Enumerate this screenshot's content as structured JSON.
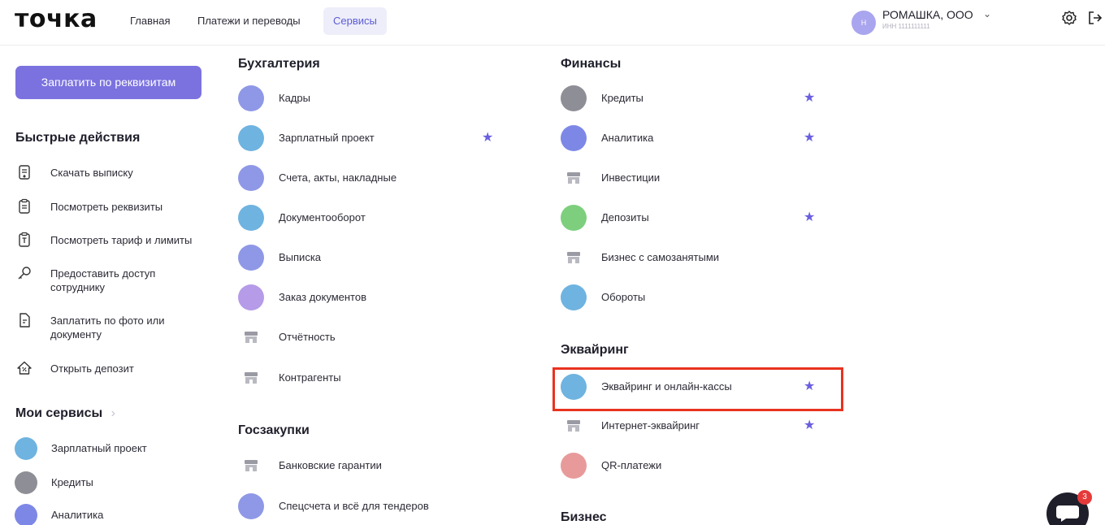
{
  "header": {
    "logo": "точка",
    "nav": [
      {
        "label": "Главная"
      },
      {
        "label": "Платежи и переводы"
      },
      {
        "label": "Сервисы"
      }
    ],
    "account": {
      "avatar": "Н",
      "name": "РОМАШКА, ООО",
      "inn": "ИНН 1111111111"
    },
    "icons": [
      "settings-icon",
      "logout-icon"
    ]
  },
  "left": {
    "pay_button": "Заплатить по реквизитам",
    "quick_actions_title": "Быстрые действия",
    "quick_actions": [
      {
        "label": "Скачать выписку",
        "icon": "statement-icon"
      },
      {
        "label": "Посмотреть реквизиты",
        "icon": "clipboard-icon"
      },
      {
        "label": "Посмотреть тариф и лимиты",
        "icon": "tariff-icon"
      },
      {
        "label": "Предоставить доступ сотруднику",
        "icon": "key-icon"
      },
      {
        "label": "Заплатить по фото или документу",
        "icon": "document-photo-icon"
      },
      {
        "label": "Открыть депозит",
        "icon": "deposit-icon"
      }
    ],
    "my_services_title": "Мои сервисы",
    "my_services": [
      {
        "label": "Зарплатный проект",
        "color": "#6fb3e0"
      },
      {
        "label": "Кредиты",
        "color": "#8e8e96"
      },
      {
        "label": "Аналитика",
        "color": "#7d88e6"
      }
    ]
  },
  "accounting": {
    "title": "Бухгалтерия",
    "items": [
      {
        "label": "Кадры",
        "color": "#8f98e6"
      },
      {
        "label": "Зарплатный проект",
        "color": "#6fb3e0",
        "starred": "★"
      },
      {
        "label": "Счета, акты, накладные",
        "color": "#8f98e6"
      },
      {
        "label": "Документооборот",
        "color": "#6fb3e0"
      },
      {
        "label": "Выписка",
        "color": "#8f98e6"
      },
      {
        "label": "Заказ документов",
        "color": "#b69be8"
      },
      {
        "label": "Отчётность",
        "color": "#9a9aa4"
      },
      {
        "label": "Контрагенты",
        "color": "#9a9aa4"
      }
    ]
  },
  "procurement": {
    "title": "Госзакупки",
    "items": [
      {
        "label": "Банковские гарантии",
        "color": "#9a9aa4"
      },
      {
        "label": "Спецсчета и всё для тендеров",
        "color": "#8f98e6"
      }
    ]
  },
  "finance": {
    "title": "Финансы",
    "items": [
      {
        "label": "Кредиты",
        "color": "#8e8e96",
        "starred": "★"
      },
      {
        "label": "Аналитика",
        "color": "#7d88e6",
        "starred": "★"
      },
      {
        "label": "Инвестиции",
        "color": "#9a9aa4"
      },
      {
        "label": "Депозиты",
        "color": "#7dcf7d",
        "starred": "★"
      },
      {
        "label": "Бизнес с самозанятыми",
        "color": "#9a9aa4"
      },
      {
        "label": "Обороты",
        "color": "#6fb3e0"
      }
    ]
  },
  "acquiring": {
    "title": "Эквайринг",
    "items": [
      {
        "label": "Эквайринг и онлайн-кассы",
        "color": "#6fb3e0",
        "starred": "★"
      },
      {
        "label": "Интернет-эквайринг",
        "color": "#9a9aa4",
        "starred": "★"
      },
      {
        "label": "QR-платежи",
        "color": "#e89a9a"
      }
    ]
  },
  "business": {
    "title": "Бизнес"
  },
  "chat": {
    "badge": "3"
  },
  "colors": {
    "accent": "#7b72e0",
    "star": "#6a5fe0",
    "highlight": "#e8331f"
  }
}
